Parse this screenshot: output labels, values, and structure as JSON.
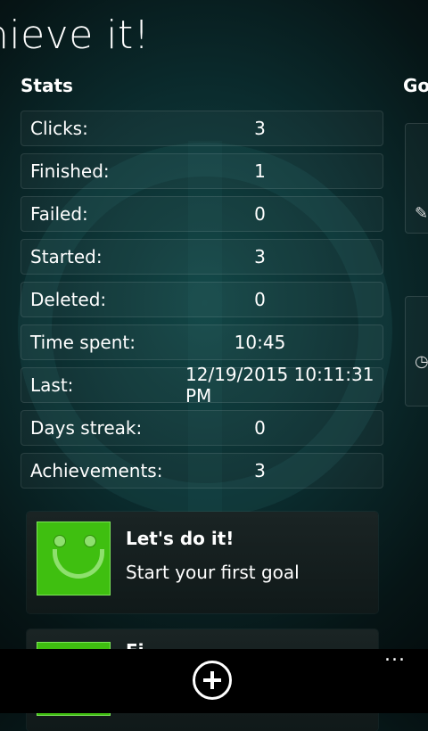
{
  "app": {
    "title": "hieve it!"
  },
  "stats": {
    "heading": "Stats",
    "rows": [
      {
        "label": "Clicks:",
        "value": "3"
      },
      {
        "label": "Finished:",
        "value": "1"
      },
      {
        "label": "Failed:",
        "value": "0"
      },
      {
        "label": "Started:",
        "value": "3"
      },
      {
        "label": "Deleted:",
        "value": "0"
      },
      {
        "label": "Time spent:",
        "value": "10:45"
      },
      {
        "label": "Last:",
        "value": "12/19/2015 10:11:31 PM"
      },
      {
        "label": "Days streak:",
        "value": "0"
      },
      {
        "label": "Achievements:",
        "value": "3"
      }
    ]
  },
  "next_section": {
    "heading": "Go"
  },
  "achievements": [
    {
      "title": "Let's do it!",
      "description": "Start your first goal",
      "icon": "smiley-icon"
    },
    {
      "title": "Fi",
      "description": "",
      "icon": "smiley-icon"
    }
  ],
  "app_bar": {
    "add_icon": "add-circle-icon",
    "more_label": "..."
  },
  "colors": {
    "accent_green": "#3fbf10",
    "background": "#0b2c2e"
  }
}
